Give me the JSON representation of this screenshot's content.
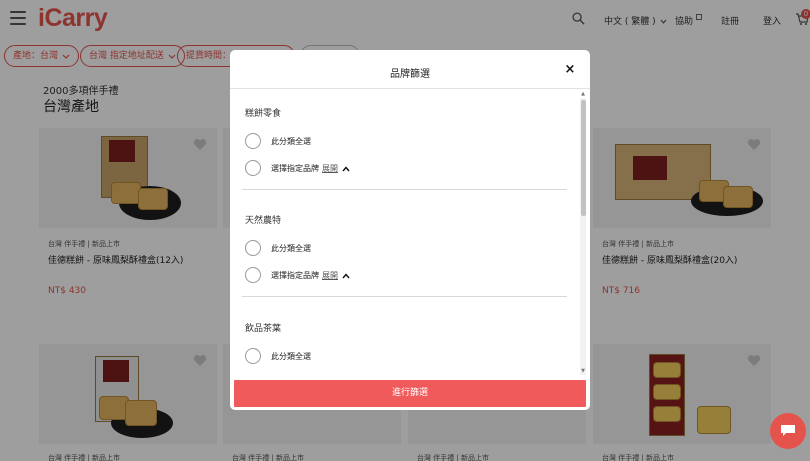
{
  "header": {
    "logo": "iCarry",
    "language": "中文 ( 繁體 )",
    "links": [
      "協助",
      "註冊",
      "登入"
    ],
    "cart_count": "0"
  },
  "filters": {
    "origin": "產地：台灣",
    "delivery": "台灣 指定地址配送",
    "ship_time": "提貨時間：",
    "more": ""
  },
  "page": {
    "subtitle": "2000多項伴手禮",
    "title": "台灣產地"
  },
  "products": [
    {
      "category": "台灣 伴手禮 | 新品上市",
      "name": "佳德糕餅 - 原味鳳梨酥禮盒(12入)",
      "price": "NT$ 430"
    },
    {
      "category": "台灣 伴手禮 | 新品上市",
      "name": "佳德糕餅 - 原味鳳梨酥禮盒(20入)",
      "price": "NT$ 716"
    },
    {
      "category": "台灣 伴手禮 | 新品上市"
    },
    {
      "category": "台灣 伴手禮 | 新品上市"
    },
    {
      "category": "台灣 伴手禮 | 新品上市"
    },
    {
      "category": "台灣 伴手禮 | 新品上市"
    }
  ],
  "modal": {
    "title": "品牌篩選",
    "close": "×",
    "sections": [
      {
        "title": "糕餅零食",
        "select_all": "此分類全選",
        "select_brand": "選擇指定品牌",
        "expand": "展開"
      },
      {
        "title": "天然農特",
        "select_all": "此分類全選",
        "select_brand": "選擇指定品牌",
        "expand": "展開"
      },
      {
        "title": "飲品茶葉",
        "select_all": "此分類全選"
      }
    ],
    "apply_label": "進行篩選"
  },
  "colors": {
    "accent": "#e4544d",
    "button": "#f05a5a",
    "overlay": "rgba(0,0,0,0.38)"
  },
  "icons": [
    "menu-icon",
    "search-icon",
    "external-link-icon",
    "cart-icon",
    "heart-icon",
    "close-icon",
    "chevron-up-icon",
    "chat-icon"
  ]
}
